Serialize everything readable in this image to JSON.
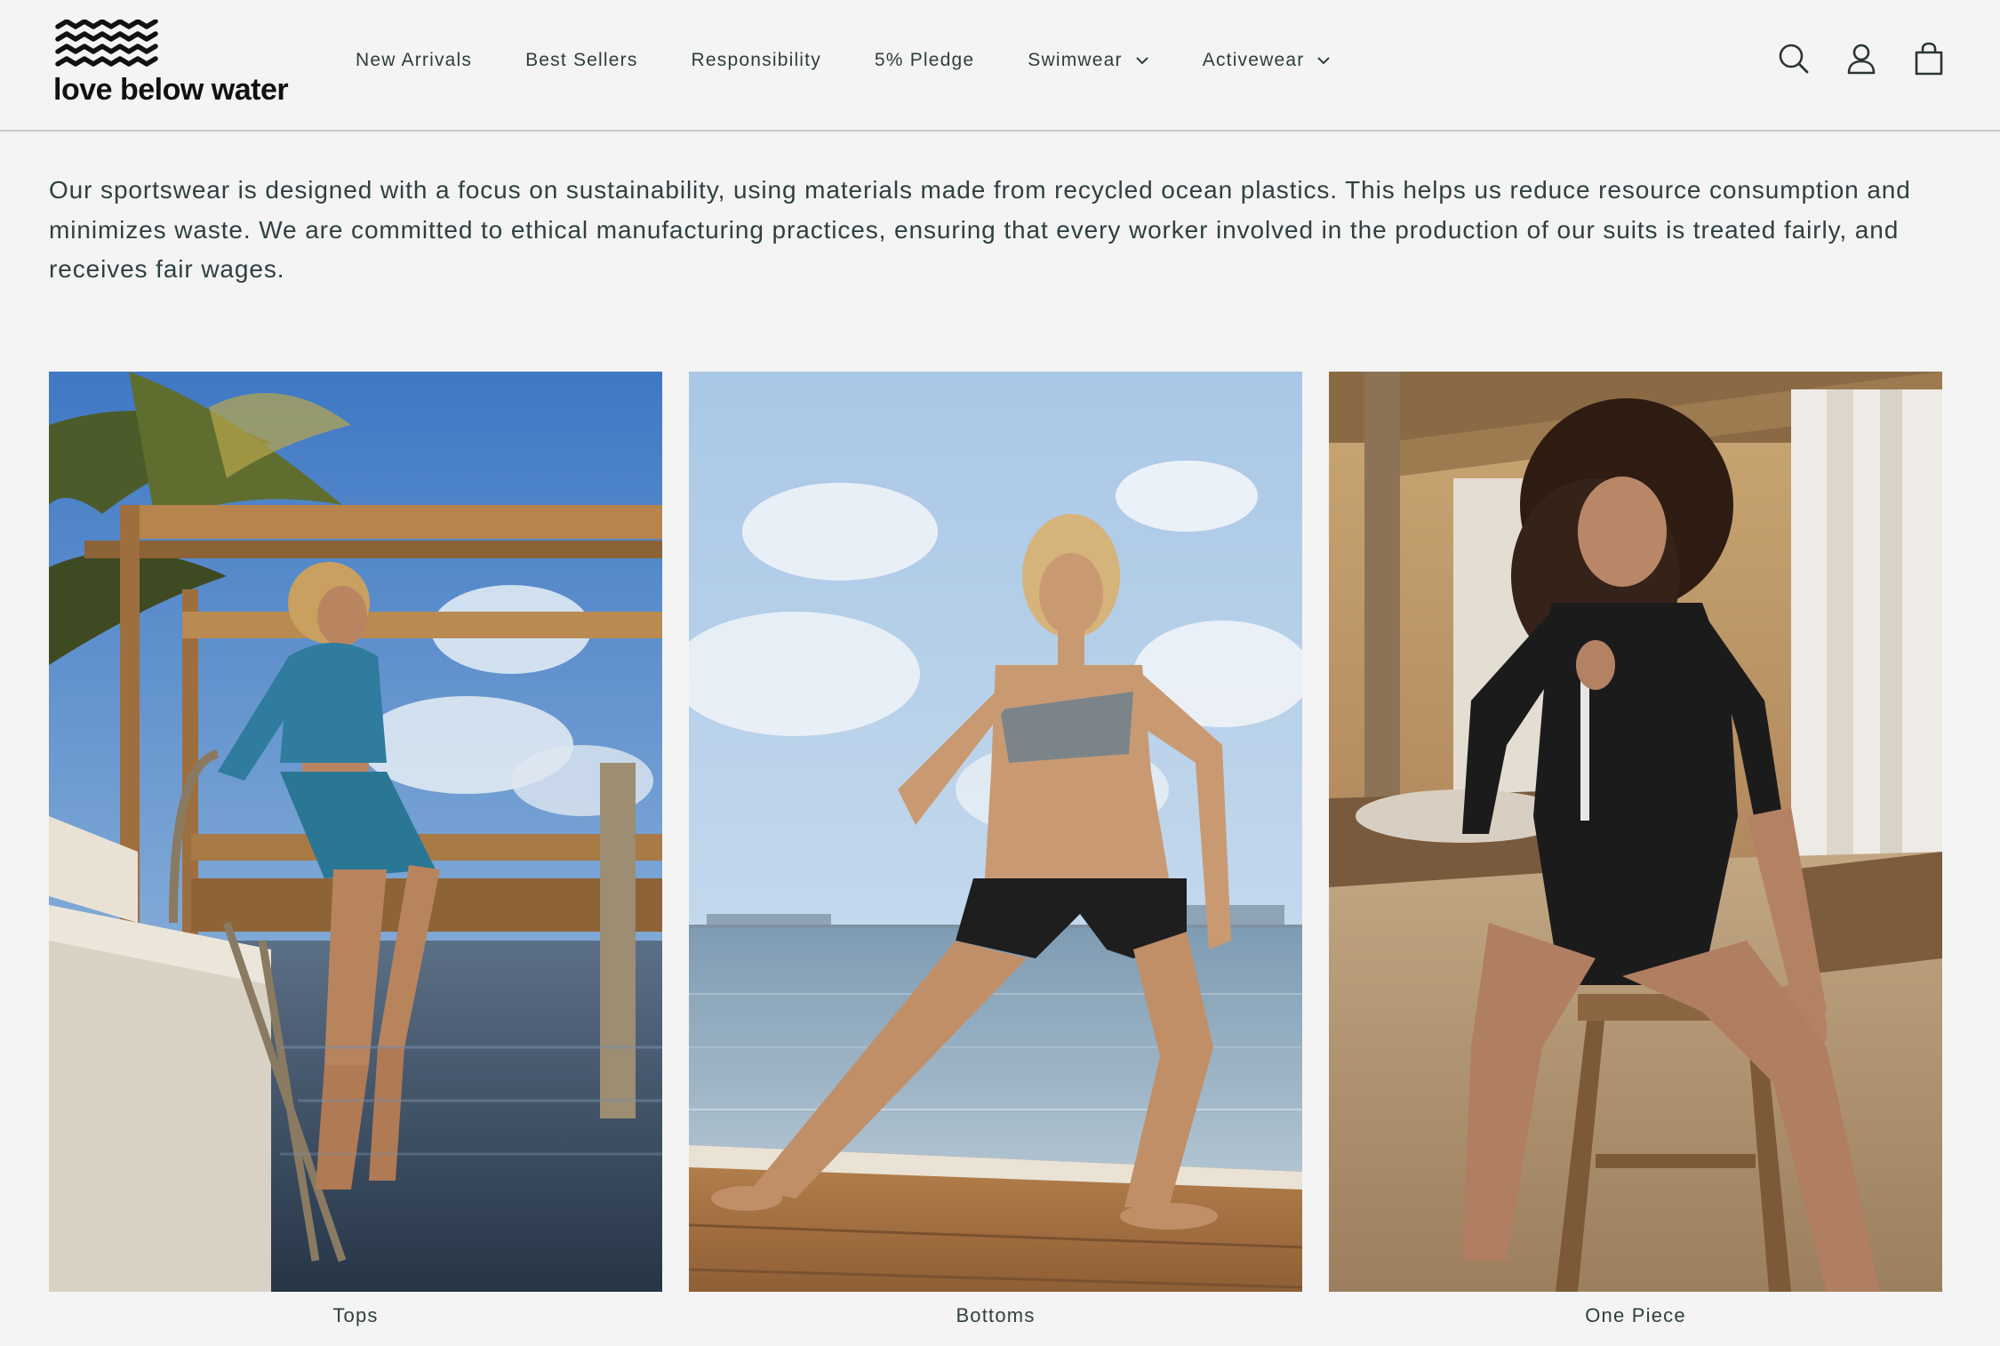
{
  "brand": {
    "name": "love below water"
  },
  "nav": {
    "items": [
      {
        "label": "New Arrivals",
        "has_dropdown": false
      },
      {
        "label": "Best Sellers",
        "has_dropdown": false
      },
      {
        "label": "Responsibility",
        "has_dropdown": false
      },
      {
        "label": "5% Pledge",
        "has_dropdown": false
      },
      {
        "label": "Swimwear",
        "has_dropdown": true
      },
      {
        "label": "Activewear",
        "has_dropdown": true
      }
    ]
  },
  "header_icons": [
    "search-icon",
    "account-icon",
    "bag-icon"
  ],
  "intro": {
    "text": "Our sportswear is designed with a focus on sustainability, using materials made from recycled ocean plastics. This helps us reduce resource consumption and minimizes waste. We are committed to ethical manufacturing practices, ensuring that every worker involved in the production of our suits is treated fairly, and receives fair wages."
  },
  "collections": [
    {
      "label": "Tops"
    },
    {
      "label": "Bottoms"
    },
    {
      "label": "One Piece"
    }
  ],
  "colors": {
    "background": "#f4f4f4",
    "text": "#2f3d3d",
    "header_border": "#c9c9c9"
  }
}
